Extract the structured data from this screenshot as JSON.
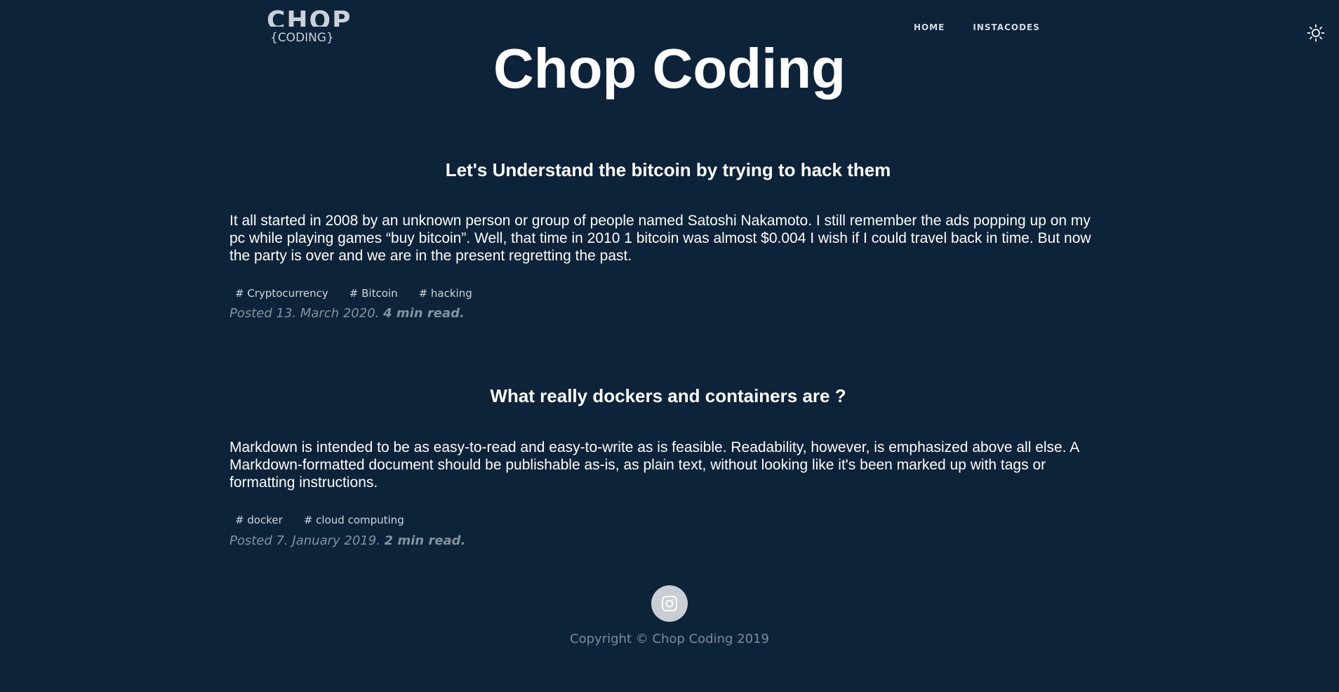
{
  "logo": {
    "top_text": "CHOP",
    "bottom_text": "{CODING}"
  },
  "nav": {
    "items": [
      {
        "label": "HOME"
      },
      {
        "label": "INSTACODES"
      }
    ]
  },
  "theme_toggle": {
    "icon": "sun-icon"
  },
  "site_title": "Chop Coding",
  "posts": [
    {
      "title": "Let's Understand the bitcoin by trying to hack them",
      "excerpt": "It all started in 2008 by an unknown person or group of people named Satoshi Nakamoto. I still remember the ads popping up on my pc while playing games “buy bitcoin”. Well, that time in 2010 1 bitcoin was almost $0.004 I wish if I could travel back in time. But now the party is over and we are in the present regretting the past.",
      "tags": [
        "# Cryptocurrency",
        "# Bitcoin",
        "# hacking"
      ],
      "posted": "Posted 13. March 2020.",
      "read_time": "4 min read."
    },
    {
      "title": "What really dockers and containers are ?",
      "excerpt": "Markdown is intended to be as easy-to-read and easy-to-write as is feasible. Readability, however, is emphasized above all else. A Markdown-formatted document should be publishable as-is, as plain text, without looking like it's been marked up with tags or formatting instructions.",
      "tags": [
        "# docker",
        "# cloud computing"
      ],
      "posted": "Posted 7. January 2019.",
      "read_time": "2 min read."
    }
  ],
  "footer": {
    "social_icon": "instagram-icon",
    "copyright": "Copyright © Chop Coding 2019"
  },
  "colors": {
    "background": "#0c2339",
    "text": "#ffffff",
    "muted": "#8593a0"
  }
}
